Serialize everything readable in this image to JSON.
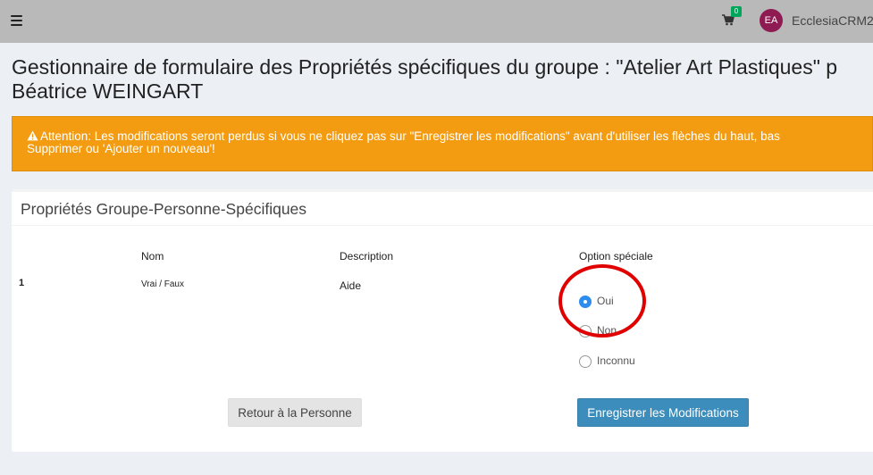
{
  "topbar": {
    "menu_icon": "hamburger-icon",
    "cart_icon": "shopping-cart-icon",
    "cart_count": "0",
    "user_initials": "EA",
    "user_name": "EcclesiaCRM2"
  },
  "page": {
    "title_line1": "Gestionnaire de formulaire des Propriétés spécifiques du groupe : \"Atelier Art Plastiques\" p",
    "title_line2": "Béatrice WEINGART"
  },
  "alert": {
    "icon": "warning-icon",
    "line1": "Attention: Les modifications seront perdus si vous ne cliquez pas sur \"Enregistrer les modifications\" avant d'utiliser les flèches du haut, bas",
    "line2": "Supprimer ou 'Ajouter un nouveau'!",
    "color": "#f39c12"
  },
  "card": {
    "title": "Propriétés Groupe-Personne-Spécifiques",
    "headers": {
      "name": "Nom",
      "description": "Description",
      "special_option": "Option spéciale"
    },
    "row": {
      "index": "1",
      "name": "Vrai / Faux",
      "description": "Aide",
      "options": [
        "Oui",
        "Non",
        "Inconnu"
      ],
      "selected": "Oui"
    },
    "buttons": {
      "back": "Retour à la Personne",
      "save": "Enregistrer les Modifications"
    }
  },
  "colors": {
    "primary": "#3c8dbc",
    "warning": "#f39c12",
    "badge": "#00a65a",
    "avatar": "#8e1b52",
    "annotation": "#e00000"
  }
}
